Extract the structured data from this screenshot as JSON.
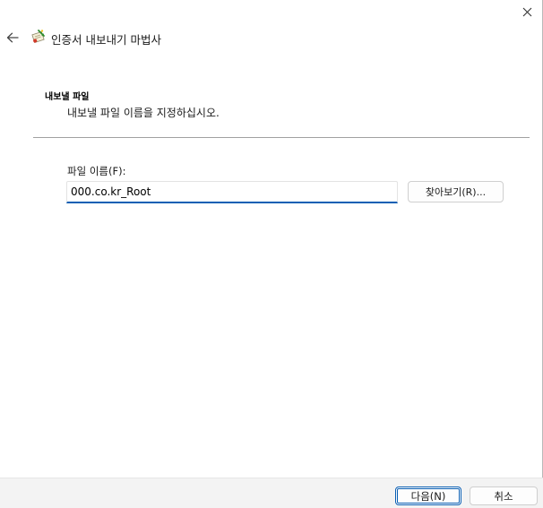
{
  "window": {
    "title": "인증서 내보내기 마법사",
    "close_icon": "close-icon",
    "back_icon": "back-arrow-icon",
    "wizard_icon": "certificate-wizard-icon"
  },
  "header": {
    "heading": "내보낼 파일",
    "description": "내보낼 파일 이름을 지정하십시오."
  },
  "form": {
    "file_label": "파일 이름(F):",
    "file_value": "000.co.kr_Root",
    "browse_label": "찾아보기(R)..."
  },
  "footer": {
    "next_label": "다음(N)",
    "cancel_label": "취소"
  },
  "colors": {
    "accent": "#0a5fb4",
    "footer_bg": "#f3f3f3",
    "divider": "#a0a0a0"
  }
}
